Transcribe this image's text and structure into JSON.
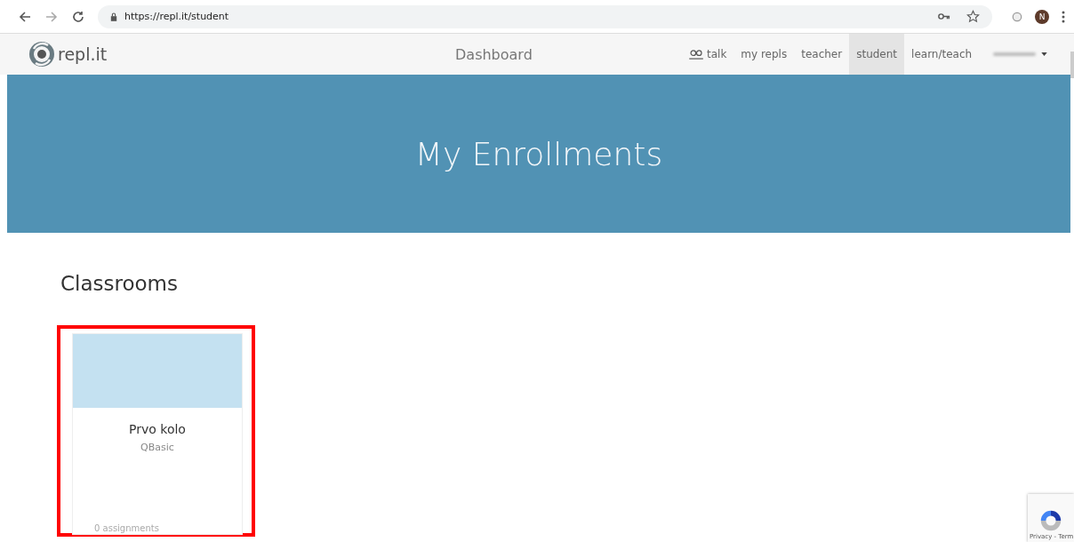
{
  "browser": {
    "url_host": "https://repl.it",
    "url_path": "/student",
    "profile_initial": "N"
  },
  "nav": {
    "logo": "repl.it",
    "title": "Dashboard",
    "items": [
      {
        "label": "talk",
        "kind": "people",
        "selected": false
      },
      {
        "label": "my repls",
        "kind": "plain",
        "selected": false
      },
      {
        "label": "teacher",
        "kind": "plain",
        "selected": false
      },
      {
        "label": "student",
        "kind": "plain",
        "selected": true
      },
      {
        "label": "learn/teach",
        "kind": "plain",
        "selected": false
      }
    ]
  },
  "hero": {
    "title": "My Enrollments"
  },
  "section": {
    "heading": "Classrooms"
  },
  "classrooms": [
    {
      "name": "Prvo kolo",
      "language": "QBasic",
      "assignments": "0 assignments",
      "highlighted": true
    }
  ],
  "recaptcha": {
    "text": "Privacy - Term"
  }
}
